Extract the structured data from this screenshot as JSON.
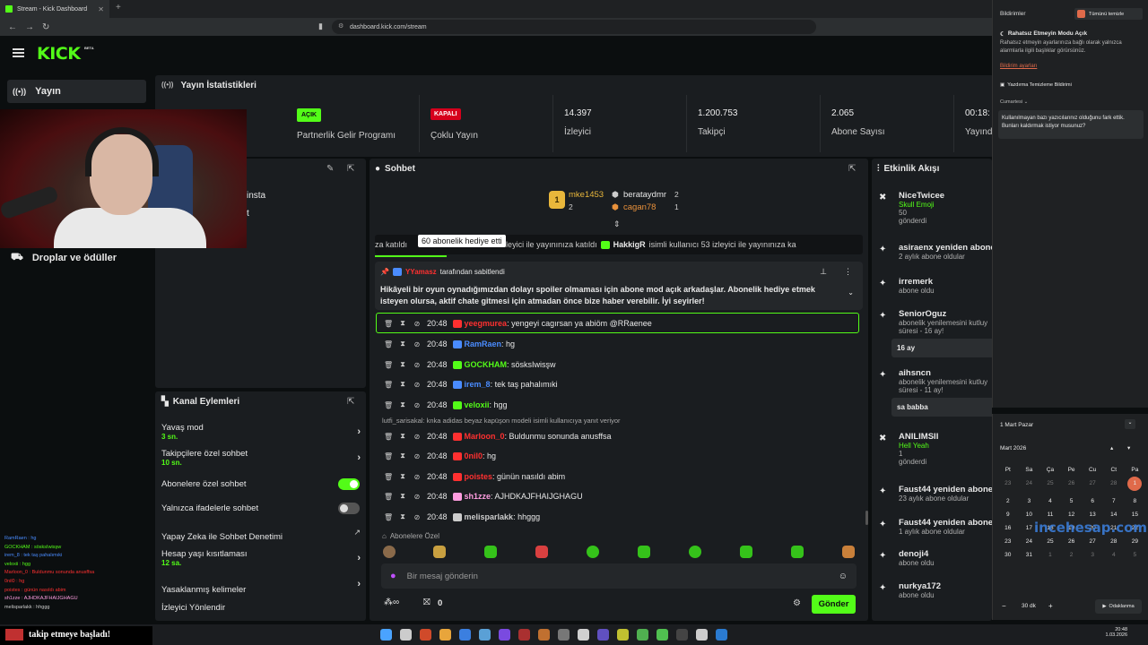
{
  "browser": {
    "tab_title": "Stream - Kick Dashboard",
    "url": "dashboard.kick.com/stream"
  },
  "app": {
    "logo": "KICK",
    "logo_badge": "BETA"
  },
  "sidebar": {
    "active_label": "Yayın",
    "drops_label": "Droplar ve ödüller"
  },
  "stats": {
    "title": "Yayın İstatistikleri",
    "partner_badge": "AÇIK",
    "partner_label": "Partnerlik Gelir Programı",
    "multi_badge": "KAPALI",
    "multi_label": "Çoklu Yayın",
    "viewers_value": "14.397",
    "viewers_label": "İzleyici",
    "followers_value": "1.200.753",
    "followers_label": "Takipçi",
    "subs_value": "2.065",
    "subs_label": "Abone Sayısı",
    "time_value": "00:18:",
    "time_label": "Yayınd"
  },
  "stream_info": {
    "partial": "insta",
    "partial2": "t"
  },
  "actions": {
    "title": "Kanal Eylemleri",
    "slow_label": "Yavaş mod",
    "slow_value": "3 sn.",
    "follower_label": "Takipçilere özel sohbet",
    "follower_value": "10 sn.",
    "sub_label": "Abonelere özel sohbet",
    "emote_label": "Yalnızca ifadelerle sohbet",
    "ai_label": "Yapay Zeka ile Sohbet Denetimi",
    "age_label": "Hesap yaşı kısıtlaması",
    "age_value": "12 sa.",
    "banned_label": "Yasaklanmış kelimeler",
    "redirect_label": "İzleyici Yönlendir"
  },
  "chat": {
    "title": "Sohbet",
    "leaders": [
      {
        "name": "mke1453",
        "count": "2"
      },
      {
        "name": "berataydmr",
        "count": "2"
      },
      {
        "name": "cagan78",
        "count": "1"
      }
    ],
    "ticker_tooltip": "60 abonelik hediye etti",
    "ticker_text": "za katıldı",
    "ticker_text2": "ullanıcı 53 izleyici ile yayınınıza katıldı",
    "ticker_user": "HakkigR",
    "ticker_text3": "isimli kullanıcı 53 izleyici ile yayınınıza ka",
    "pinned_by": "YYamasz",
    "pinned_suffix": "tarafından sabitlendi",
    "pinned_text": "Hikâyeli bir oyun oynadığımızdan dolayı spoiler olmaması için abone mod açık arkadaşlar. Abonelik hediye etmek isteyen olursa, aktif chate gitmesi için atmadan önce bize haber verebilir. İyi seyirler!",
    "messages": [
      {
        "time": "20:48",
        "user": "yeegmurea",
        "color": "#ff3030",
        "text": ": yengeyi cagırsan ya abiöm @RRaenee"
      },
      {
        "time": "20:48",
        "user": "RamRaen",
        "color": "#4a8cff",
        "text": ": hg"
      },
      {
        "time": "20:48",
        "user": "GOCKHAM",
        "color": "#53fc18",
        "text": ": sösksIwisşw"
      },
      {
        "time": "20:48",
        "user": "irem_8",
        "color": "#4a8cff",
        "text": ": tek taş pahalımıki"
      },
      {
        "time": "20:48",
        "user": "veloxii",
        "color": "#53fc18",
        "text": ": hgg"
      },
      {
        "time": "20:48",
        "user": "Marloon_0",
        "color": "#ff3030",
        "text": ": Buldunmu sonunda anusffsa"
      },
      {
        "time": "20:48",
        "user": "0nil0",
        "color": "#ff3030",
        "text": ": hg"
      },
      {
        "time": "20:48",
        "user": "poistes",
        "color": "#ff3030",
        "text": ": günün nasıldı abim"
      },
      {
        "time": "20:48",
        "user": "sh1zze",
        "color": "#ff9de0",
        "text": ": AJHDKAJFHAIJGHAGU"
      },
      {
        "time": "20:48",
        "user": "melisparlakk",
        "color": "#ccc",
        "text": ": hhggg"
      }
    ],
    "reply_hint": "lutfi_sarisakal: knka adidas beyaz kapüşon modeli isimli kullanıcıya yanıt veriyor",
    "subs_only": "Abonelere Özel",
    "input_placeholder": "Bir mesaj gönderin",
    "points": "0",
    "send_label": "Gönder"
  },
  "activity": {
    "title": "Etkinlik Akışı",
    "items": [
      {
        "name": "NiceTwicee",
        "sub": "Skull Emoji",
        "sub2": "50",
        "sub3": "gönderdi"
      },
      {
        "name": "asiraenx yeniden abone",
        "sub": "2 aylık abone oldular"
      },
      {
        "name": "irremerk",
        "sub": "abone oldu"
      },
      {
        "name": "SeniorOguz",
        "sub": "abonelik yenilemesini kutluy",
        "sub2": "süresi - 16 ay!",
        "chip": "16 ay"
      },
      {
        "name": "aihsncn",
        "sub": "abonelik yenilemesini kutluy",
        "sub2": "süresi - 11 ay!",
        "chip": "sa babba"
      },
      {
        "name": "ANILIMSII",
        "sub": "Hell Yeah",
        "sub2": "1",
        "sub3": "gönderdi"
      },
      {
        "name": "Faust44 yeniden abone",
        "sub": "23 aylık abone oldular"
      },
      {
        "name": "Faust44 yeniden abone",
        "sub": "1 aylık abone oldular"
      },
      {
        "name": "denoji4",
        "sub": "abone oldu"
      },
      {
        "name": "nurkya172",
        "sub": "abone oldu"
      }
    ]
  },
  "notifications": {
    "title": "Bildirimler",
    "clear_all": "Tümünü temizle",
    "dnd_title": "Rahatsız Etmeyin Modu Açık",
    "dnd_text": "Rahatsız etmeyin ayarlarınıza bağlı olarak yalnızca alarmlarla ilgili başlıklar görürsünüz.",
    "settings_link": "Bildirim ayarları",
    "cleanup": "Yazdırma Temizleme Bildirimi",
    "day": "Cumartesi",
    "message": "Kullanılmayan bazı yazıcılarınız olduğunu fark ettik. Bunları kaldırmak istiyor musunuz?"
  },
  "calendar": {
    "header": "1 Mart Pazar",
    "month": "Mart 2026",
    "weekdays": [
      "Pt",
      "Sa",
      "Ça",
      "Pe",
      "Cu",
      "Ct",
      "Pa"
    ],
    "days": [
      "23",
      "24",
      "25",
      "26",
      "27",
      "28",
      "1",
      "2",
      "3",
      "4",
      "5",
      "6",
      "7",
      "8",
      "9",
      "10",
      "11",
      "12",
      "13",
      "14",
      "15",
      "16",
      "17",
      "18",
      "19",
      "20",
      "21",
      "22",
      "23",
      "24",
      "25",
      "26",
      "27",
      "28",
      "29",
      "30",
      "31",
      "1",
      "2",
      "3",
      "4",
      "5"
    ],
    "focus_minutes": "30 dk",
    "focus_label": "Odaklanma",
    "watermark": "incehesap.com"
  },
  "taskbar": {
    "time": "20:48",
    "date": "1.03.2026"
  },
  "overlay": {
    "follow_alert": "takip etmeye başladı!"
  },
  "stream_chat": [
    "RamRaen : hg",
    "GOCKHAM : sösksIwisşw",
    "irem_8 : tek taş pahalımıki",
    "veloxii : hgg",
    "Marloon_0 : Buldunmu sonunda anusffsa",
    "0nil0 : hg",
    "poistes : günün nasıldı abim",
    "sh1zze : AJHDKAJFHAIJGHAGU",
    "melisparlakk : hhggg"
  ]
}
